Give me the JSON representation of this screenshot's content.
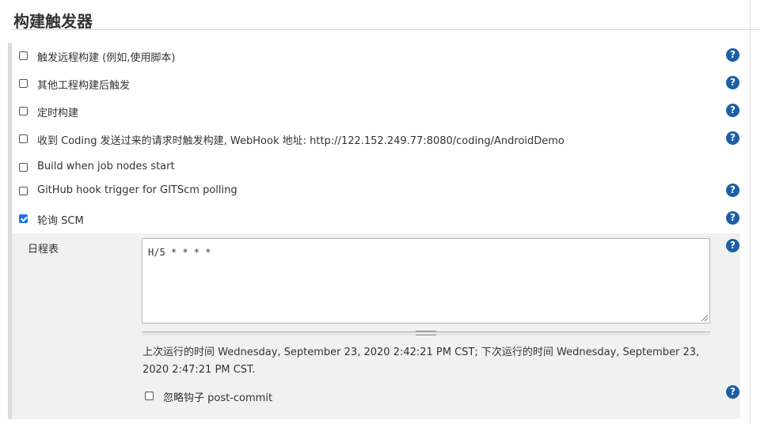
{
  "section": {
    "title": "构建触发器"
  },
  "triggers": [
    {
      "label": "触发远程构建 (例如,使用脚本)",
      "checked": false,
      "help": true
    },
    {
      "label": "其他工程构建后触发",
      "checked": false,
      "help": true
    },
    {
      "label": "定时构建",
      "checked": false,
      "help": true
    },
    {
      "label": "收到 Coding 发送过来的请求时触发构建, WebHook 地址: http://122.152.249.77:8080/coding/AndroidDemo",
      "checked": false,
      "help": true
    },
    {
      "label": "Build when job nodes start",
      "checked": false,
      "help": false
    },
    {
      "label": "GitHub hook trigger for GITScm polling",
      "checked": false,
      "help": true
    },
    {
      "label": "轮询 SCM",
      "checked": true,
      "help": true
    }
  ],
  "scm": {
    "schedule_label": "日程表",
    "schedule_value": "H/5 * * * *",
    "run_info": "上次运行的时间 Wednesday, September 23, 2020 2:42:21 PM CST; 下次运行的时间 Wednesday, September 23, 2020 2:47:21 PM CST.",
    "ignore_hooks_label": "忽略钩子 post-commit",
    "ignore_hooks_checked": false
  },
  "help_glyph": "?",
  "icons": {
    "help": "question-circle-icon",
    "check": "checkmark-icon"
  },
  "colors": {
    "help_icon": "#1b5fa6",
    "checkbox_checked": "#1a73e8",
    "panel_bg": "#f1f1f1"
  }
}
